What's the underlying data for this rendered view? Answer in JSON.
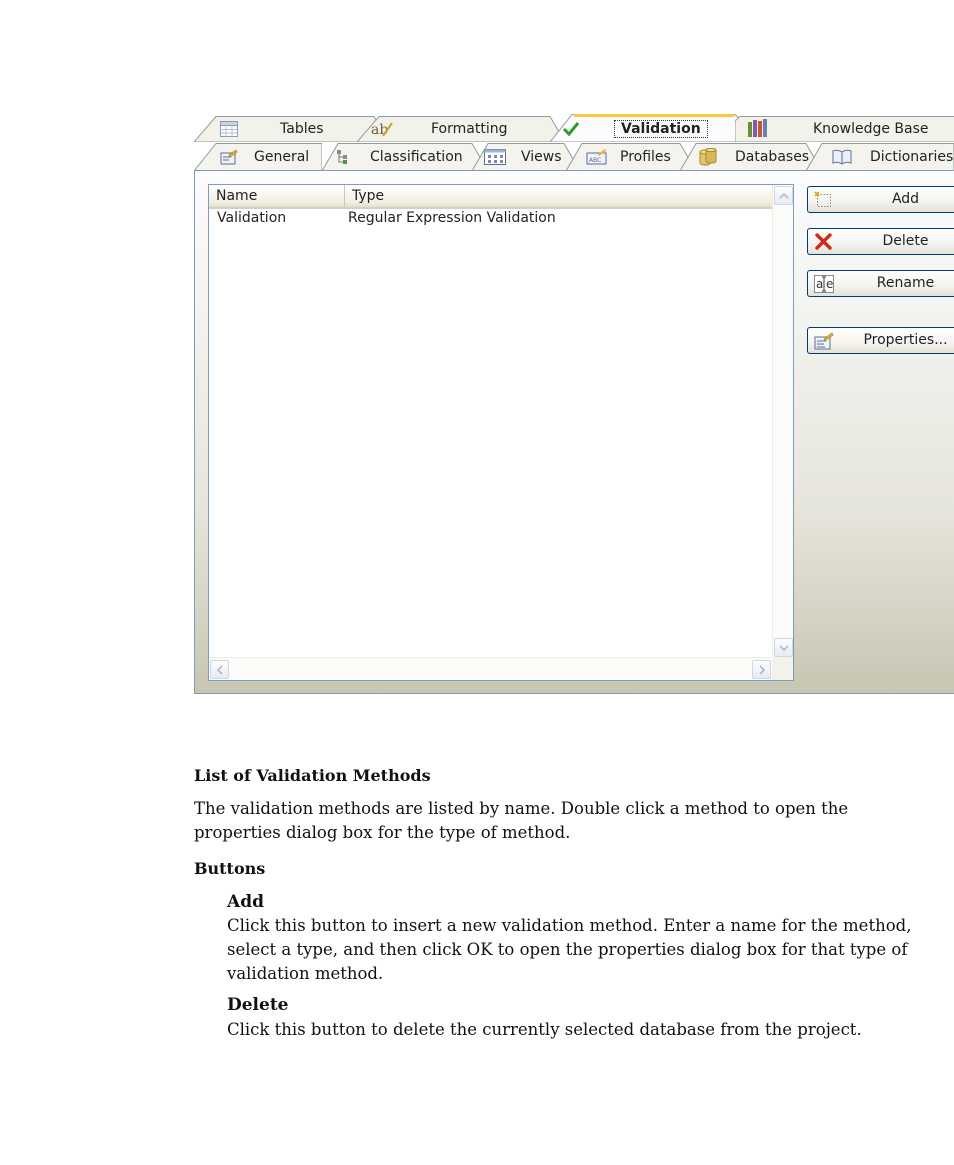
{
  "tabs": {
    "row_back": [
      "Tables",
      "Formatting",
      "Validation",
      "Knowledge Base"
    ],
    "row_front": [
      "General",
      "Classification",
      "Views",
      "Profiles",
      "Databases",
      "Dictionaries"
    ],
    "icons": {
      "Tables": "table-icon",
      "Formatting": "ab-pen-icon",
      "Validation": "checkmark-icon",
      "Knowledge Base": "books-icon",
      "General": "properties-icon",
      "Classification": "tree-icon",
      "Views": "grid-view-icon",
      "Profiles": "abc-profile-icon",
      "Databases": "database-icon",
      "Dictionaries": "open-book-icon"
    },
    "active": "Validation"
  },
  "list": {
    "columns": [
      "Name",
      "Type"
    ],
    "rows": [
      {
        "name": "Validation",
        "type": "Regular Expression Validation"
      }
    ]
  },
  "buttons": {
    "add": "Add",
    "delete": "Delete",
    "rename": "Rename",
    "properties": "Properties..."
  },
  "colors": {
    "tab_border": "#919b9c",
    "panel_border": "#7f9db9",
    "button_border": "#003c74",
    "active_tab_top": "#ffc83c",
    "delete_red": "#cc2a1e"
  },
  "doc": {
    "heading_list": "List of Validation Methods",
    "para_list": [
      "The validation methods are listed by name. Double click a method to open the",
      "properties dialog box for the type of method."
    ],
    "heading_buttons": "Buttons",
    "add_title": "Add",
    "add_desc": [
      "Click this button to insert a new validation method. Enter a name for the method,",
      "select a type, and then click OK to open the properties dialog box for that type of",
      "validation method."
    ],
    "delete_title": "Delete",
    "delete_desc": "Click this button to delete the currently selected database from the project."
  }
}
